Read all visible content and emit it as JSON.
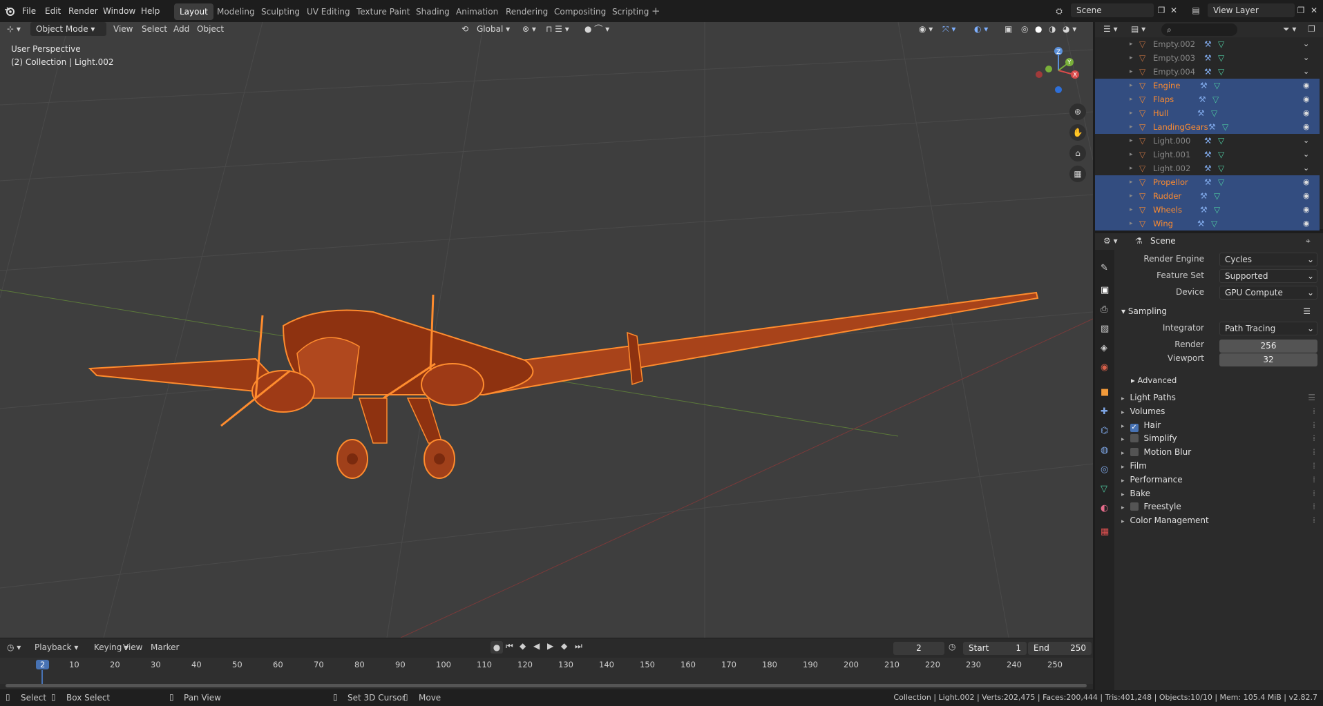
{
  "menus": [
    "File",
    "Edit",
    "Render",
    "Window",
    "Help"
  ],
  "workspaces": [
    {
      "label": "Layout",
      "active": true
    },
    {
      "label": "Modeling"
    },
    {
      "label": "Sculpting"
    },
    {
      "label": "UV Editing"
    },
    {
      "label": "Texture Paint"
    },
    {
      "label": "Shading"
    },
    {
      "label": "Animation"
    },
    {
      "label": "Rendering"
    },
    {
      "label": "Compositing"
    },
    {
      "label": "Scripting"
    }
  ],
  "scene_name": "Scene",
  "view_layer": "View Layer",
  "viewport": {
    "mode": "Object Mode",
    "menus": [
      "View",
      "Select",
      "Add",
      "Object"
    ],
    "orientation": "Global",
    "perspective": "User Perspective",
    "collection": "(2) Collection | Light.002",
    "gizmo_axes": {
      "x": "X",
      "y": "Y",
      "z": "Z"
    }
  },
  "outliner": {
    "rows": [
      {
        "name": "Empty.002",
        "selected": false,
        "color": "#888888"
      },
      {
        "name": "Empty.003",
        "selected": false,
        "color": "#888888"
      },
      {
        "name": "Empty.004",
        "selected": false,
        "color": "#888888"
      },
      {
        "name": "Engine",
        "selected": true,
        "color": "#ff8c2e"
      },
      {
        "name": "Flaps",
        "selected": true,
        "color": "#ff8c2e"
      },
      {
        "name": "Hull",
        "selected": true,
        "color": "#ff8c2e"
      },
      {
        "name": "LandingGears",
        "selected": true,
        "color": "#ff8c2e"
      },
      {
        "name": "Light.000",
        "selected": false,
        "color": "#888888"
      },
      {
        "name": "Light.001",
        "selected": false,
        "color": "#888888"
      },
      {
        "name": "Light.002",
        "selected": false,
        "color": "#888888"
      },
      {
        "name": "Propellor",
        "selected": true,
        "color": "#ff8c2e"
      },
      {
        "name": "Rudder",
        "selected": true,
        "color": "#ff8c2e"
      },
      {
        "name": "Wheels",
        "selected": true,
        "color": "#ff8c2e"
      },
      {
        "name": "Wing",
        "selected": true,
        "color": "#ff8c2e"
      }
    ]
  },
  "properties": {
    "context": "Scene",
    "render_engine_label": "Render Engine",
    "render_engine": "Cycles",
    "feature_set_label": "Feature Set",
    "feature_set": "Supported",
    "device_label": "Device",
    "device": "GPU Compute",
    "sampling": "Sampling",
    "integrator_label": "Integrator",
    "integrator": "Path Tracing",
    "render_label": "Render",
    "render_samples": "256",
    "viewport_label": "Viewport",
    "viewport_samples": "32",
    "advanced": "Advanced",
    "sections": [
      {
        "label": "Light Paths",
        "check": null,
        "list": true
      },
      {
        "label": "Volumes",
        "check": null
      },
      {
        "label": "Hair",
        "check": true
      },
      {
        "label": "Simplify",
        "check": false
      },
      {
        "label": "Motion Blur",
        "check": false
      },
      {
        "label": "Film",
        "check": null
      },
      {
        "label": "Performance",
        "check": null
      },
      {
        "label": "Bake",
        "check": null
      },
      {
        "label": "Freestyle",
        "check": false
      },
      {
        "label": "Color Management",
        "check": null
      }
    ]
  },
  "timeline": {
    "menus": [
      "Playback",
      "Keying",
      "View",
      "Marker"
    ],
    "current_frame": "2",
    "start_label": "Start",
    "start": "1",
    "end_label": "End",
    "end": "250",
    "ticks": [
      "2",
      "10",
      "20",
      "30",
      "40",
      "50",
      "60",
      "70",
      "80",
      "90",
      "100",
      "110",
      "120",
      "130",
      "140",
      "150",
      "160",
      "170",
      "180",
      "190",
      "200",
      "210",
      "220",
      "230",
      "240",
      "250"
    ]
  },
  "status": {
    "select": "Select",
    "box_select": "Box Select",
    "pan_view": "Pan View",
    "cursor": "Set 3D Cursor",
    "move": "Move",
    "info": "Collection | Light.002 | Verts:202,475 | Faces:200,444 | Tris:401,248 | Objects:10/10 | Mem: 105.4 MiB | v2.82.7"
  },
  "colors": {
    "selection": "#334d80",
    "accent": "#4772b3",
    "object_orange": "#ff8c2e",
    "viewport_bg": "#3e3e3e"
  }
}
